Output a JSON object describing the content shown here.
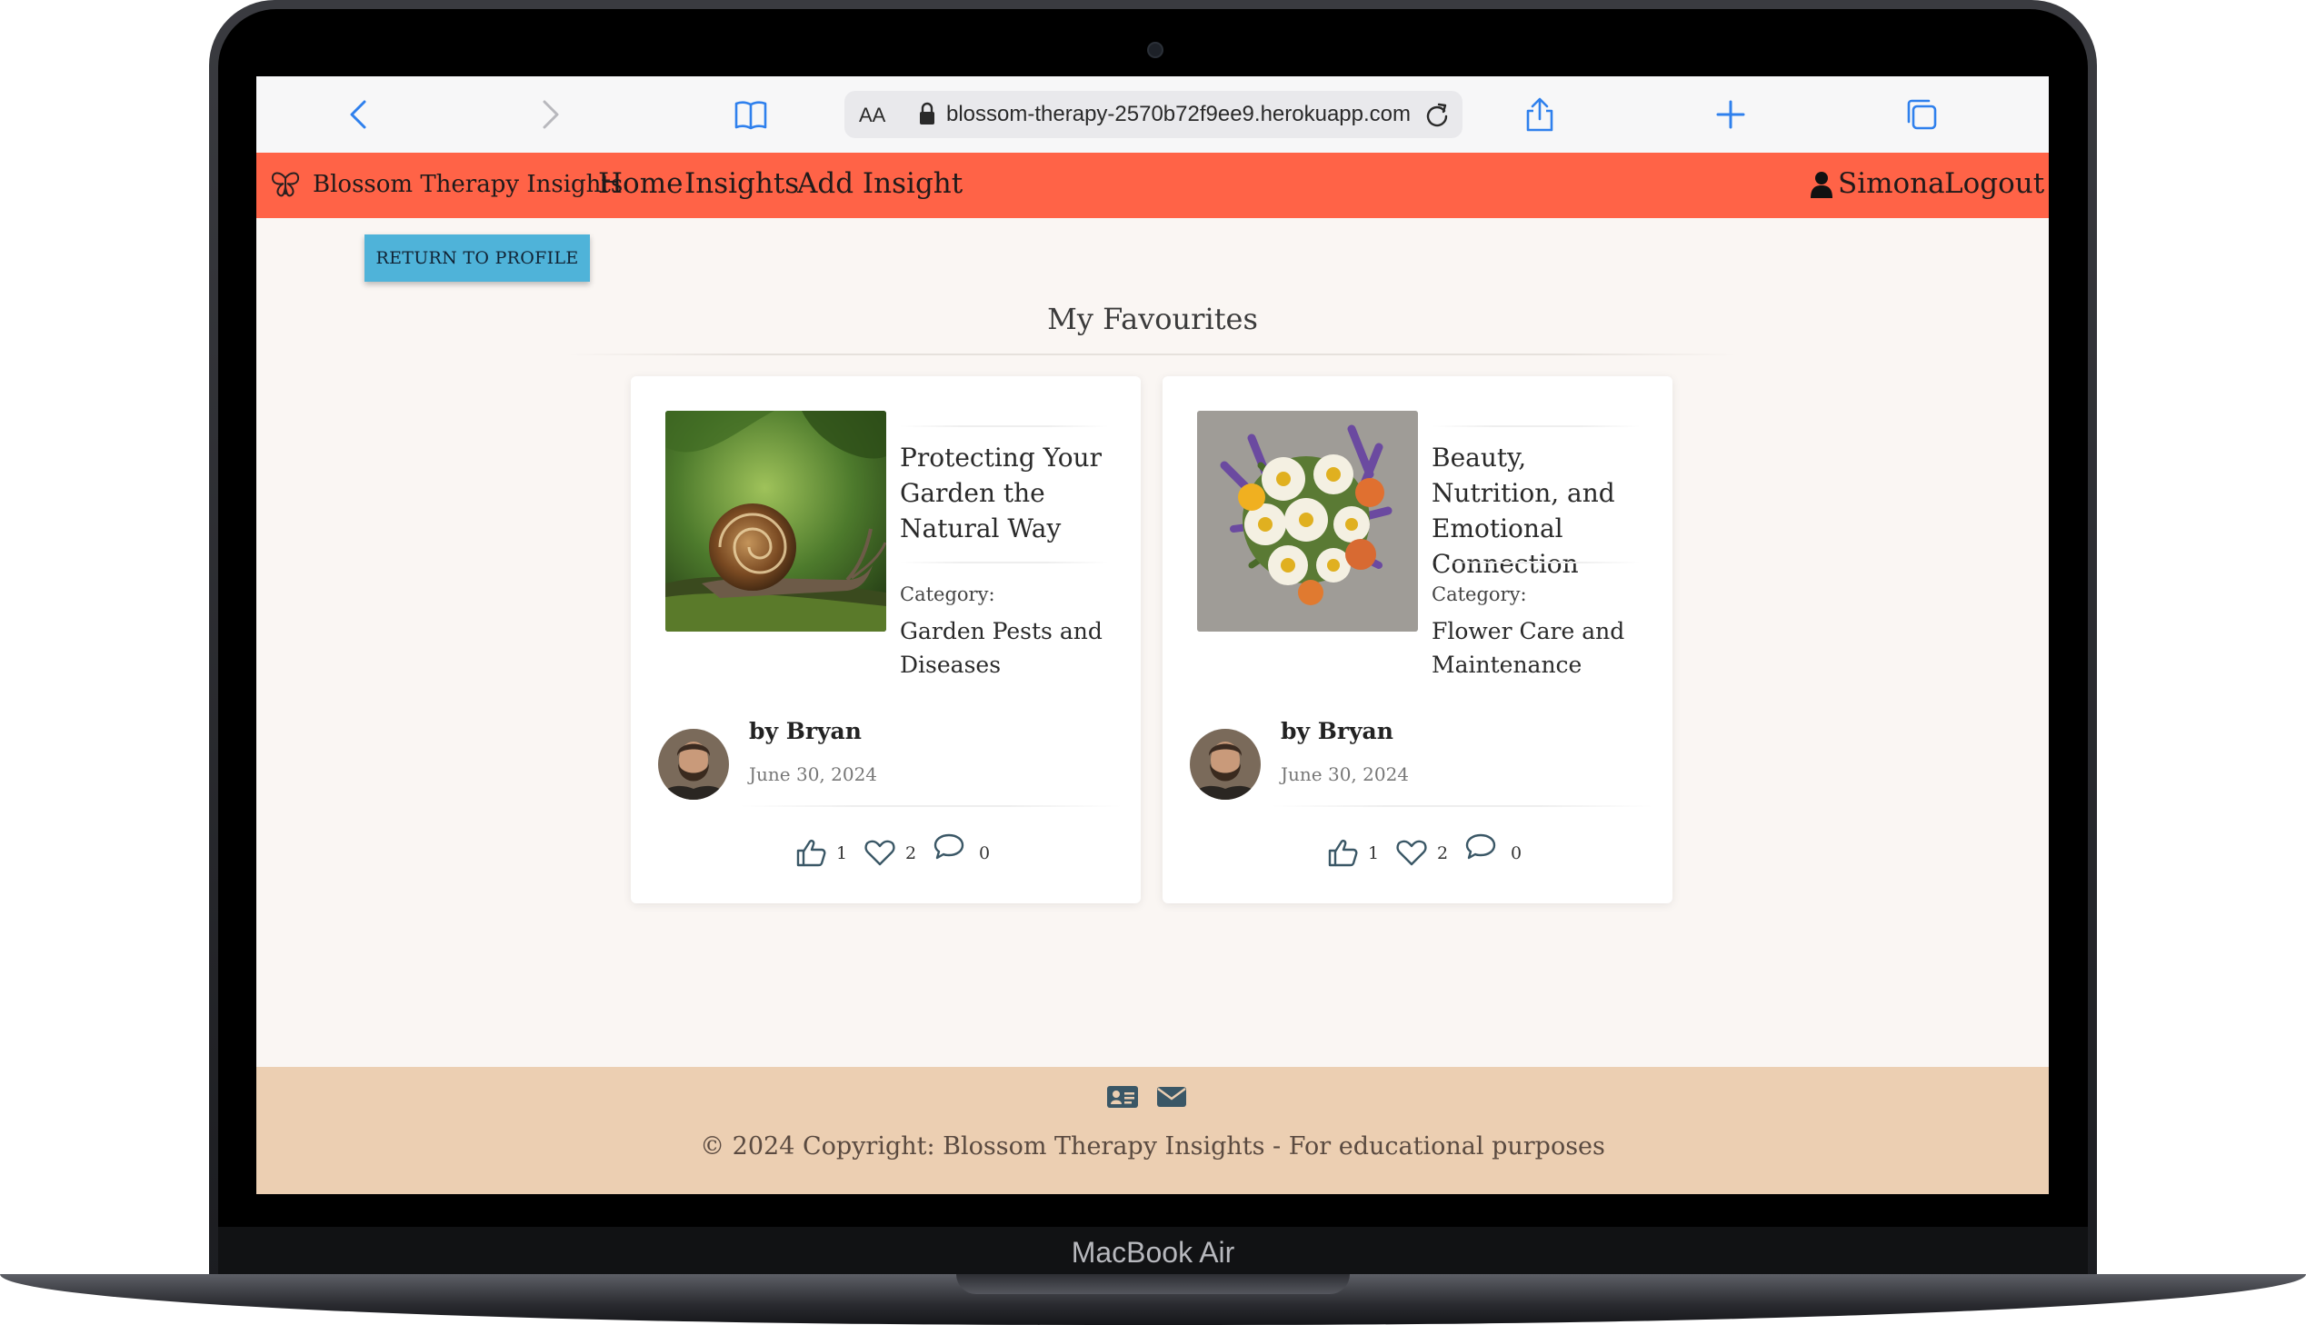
{
  "device": {
    "label": "MacBook Air"
  },
  "browser": {
    "text_size_label": "AA",
    "url": "blossom-therapy-2570b72f9ee9.herokuapp.com"
  },
  "navbar": {
    "brand": "Blossom Therapy Insights",
    "links": [
      "Home",
      "Insights",
      "Add Insight"
    ],
    "user": "Simona",
    "logout": "Logout",
    "color": "#ff6347"
  },
  "page": {
    "return_button": "RETURN TO PROFILE",
    "heading": "My Favourites"
  },
  "cards": [
    {
      "title": "Protecting Your Garden the Natural Way",
      "category_label": "Category:",
      "category": "Garden Pests and Diseases",
      "author": "by Bryan",
      "date": "June 30, 2024",
      "likes": "1",
      "favourites": "2",
      "comments": "0",
      "image": "snail-photo"
    },
    {
      "title": "Beauty, Nutrition, and Emotional Connection",
      "category_label": "Category:",
      "category": "Flower Care and Maintenance",
      "author": "by Bryan",
      "date": "June 30, 2024",
      "likes": "1",
      "favourites": "2",
      "comments": "0",
      "image": "flower-bouquet-photo"
    }
  ],
  "footer": {
    "icons": [
      "contact-card-icon",
      "envelope-icon"
    ],
    "copyright": "© 2024 Copyright: Blossom Therapy Insights - For educational purposes",
    "color": "#eccfb2"
  }
}
